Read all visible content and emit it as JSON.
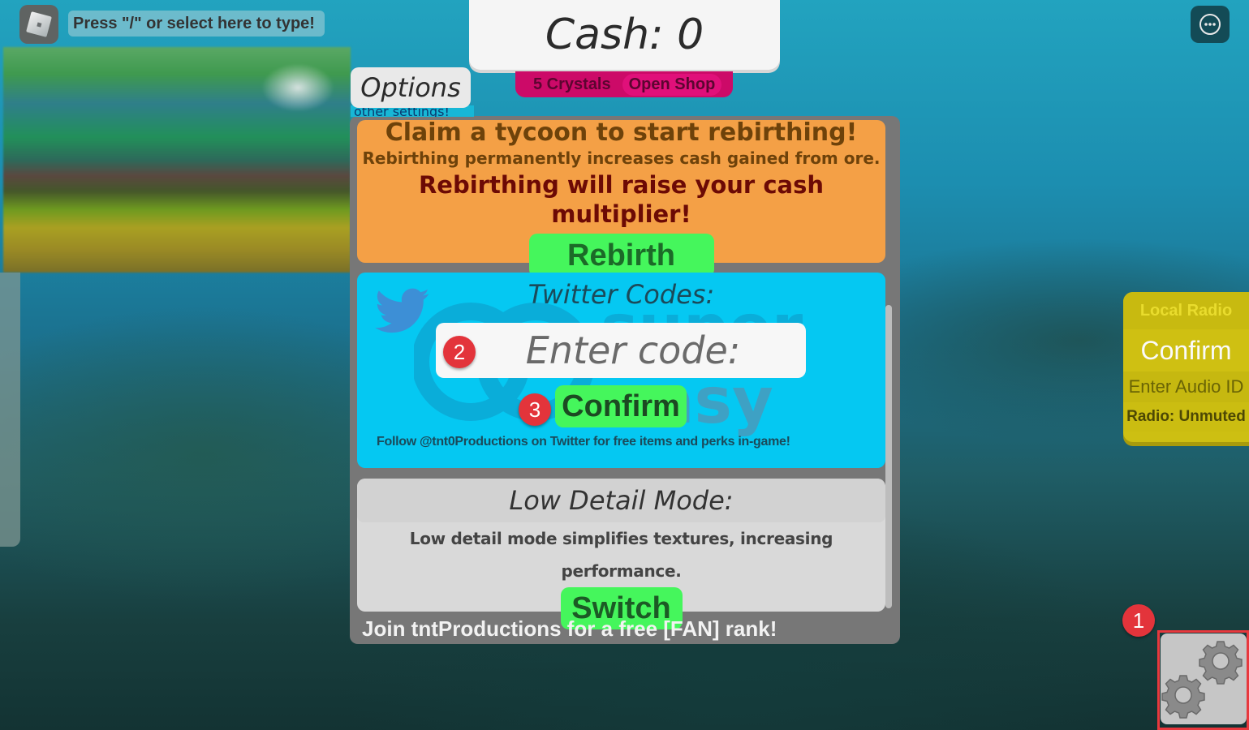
{
  "chat": {
    "logo_icon": "roblox-logo-icon",
    "prompt": "Press \"/\" or select here to type!"
  },
  "hud": {
    "cash_label": "Cash: 0",
    "crystals": "5 Crystals",
    "open_shop": "Open Shop"
  },
  "options": {
    "tab_label": "Options",
    "other_settings_label": "other settings!",
    "rebirth": {
      "title": "Claim a tycoon to start rebirthing!",
      "subtitle": "Rebirthing permanently increases cash gained from ore.",
      "warning": "Rebirthing will raise your cash multiplier!",
      "button": "Rebirth"
    },
    "twitter": {
      "icon": "twitter-bird-icon",
      "title": "Twitter Codes:",
      "input_placeholder": "Enter code:",
      "input_value": "",
      "confirm_button": "Confirm",
      "follow_text": "Follow @tnt0Productions on Twitter for free items and perks in-game!"
    },
    "low_detail": {
      "title": "Low Detail Mode:",
      "description": "Low detail mode simplifies textures, increasing performance.",
      "button": "Switch"
    },
    "join_text": "Join tntProductions for a free [FAN] rank!"
  },
  "radio": {
    "title": "Local Radio",
    "confirm": "Confirm",
    "audio_placeholder": "Enter Audio ID",
    "status": "Radio: Unmuted"
  },
  "menu": {
    "icon": "more-options-icon"
  },
  "settings": {
    "icon": "gears-icon"
  },
  "annotations": {
    "step1": "1",
    "step2": "2",
    "step3": "3",
    "highlight_color": "#e8383d"
  },
  "watermark": {
    "text_top": "super",
    "text_bottom": "easy"
  },
  "colors": {
    "rebirth_bg": "#f4a046",
    "twitter_bg": "#05c8f2",
    "green_button": "#45f65c",
    "crystal_bar": "#cc0a68",
    "radio_bg": "#cdbf12"
  }
}
